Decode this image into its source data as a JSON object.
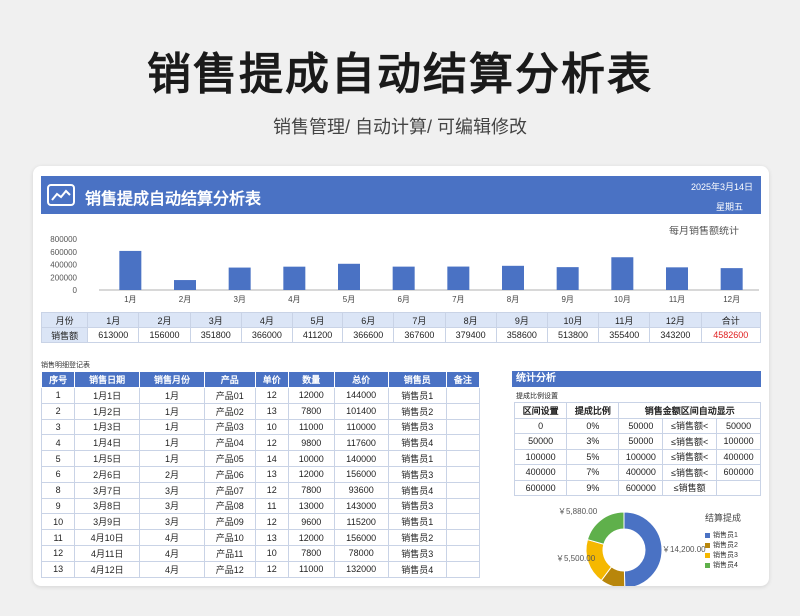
{
  "page": {
    "title": "销售提成自动结算分析表",
    "subtitle": "销售管理/ 自动计算/ 可编辑修改"
  },
  "banner": {
    "title": "销售提成自动结算分析表",
    "date": "2025年3月14日",
    "weekday": "星期五"
  },
  "chart_data": {
    "type": "bar",
    "title": "每月销售额统计",
    "categories": [
      "1月",
      "2月",
      "3月",
      "4月",
      "5月",
      "6月",
      "7月",
      "8月",
      "9月",
      "10月",
      "11月",
      "12月"
    ],
    "values": [
      613000,
      156000,
      351800,
      366000,
      411200,
      366600,
      367600,
      379400,
      358600,
      513800,
      355400,
      343200
    ],
    "ylim": [
      0,
      800000
    ],
    "yticks": [
      "800000",
      "600000",
      "400000",
      "200000",
      "0"
    ],
    "color": "#4a72c4"
  },
  "monthly": {
    "month_label": "月份",
    "sales_label": "销售额",
    "total_label": "合计",
    "months": [
      "1月",
      "2月",
      "3月",
      "4月",
      "5月",
      "6月",
      "7月",
      "8月",
      "9月",
      "10月",
      "11月",
      "12月"
    ],
    "values": [
      "613000",
      "156000",
      "351800",
      "366000",
      "411200",
      "366600",
      "367600",
      "379400",
      "358600",
      "513800",
      "355400",
      "343200"
    ],
    "total": "4582600"
  },
  "detail": {
    "label": "销售明细登记表",
    "headers": [
      "序号",
      "销售日期",
      "销售月份",
      "产品",
      "单价",
      "数量",
      "总价",
      "销售员",
      "备注"
    ],
    "rows": [
      [
        "1",
        "1月1日",
        "1月",
        "产品01",
        "12",
        "12000",
        "144000",
        "销售员1",
        ""
      ],
      [
        "2",
        "1月2日",
        "1月",
        "产品02",
        "13",
        "7800",
        "101400",
        "销售员2",
        ""
      ],
      [
        "3",
        "1月3日",
        "1月",
        "产品03",
        "10",
        "11000",
        "110000",
        "销售员3",
        ""
      ],
      [
        "4",
        "1月4日",
        "1月",
        "产品04",
        "12",
        "9800",
        "117600",
        "销售员4",
        ""
      ],
      [
        "5",
        "1月5日",
        "1月",
        "产品05",
        "14",
        "10000",
        "140000",
        "销售员1",
        ""
      ],
      [
        "6",
        "2月6日",
        "2月",
        "产品06",
        "13",
        "12000",
        "156000",
        "销售员3",
        ""
      ],
      [
        "8",
        "3月7日",
        "3月",
        "产品07",
        "12",
        "7800",
        "93600",
        "销售员4",
        ""
      ],
      [
        "9",
        "3月8日",
        "3月",
        "产品08",
        "11",
        "13000",
        "143000",
        "销售员3",
        ""
      ],
      [
        "10",
        "3月9日",
        "3月",
        "产品09",
        "12",
        "9600",
        "115200",
        "销售员1",
        ""
      ],
      [
        "11",
        "4月10日",
        "4月",
        "产品10",
        "13",
        "12000",
        "156000",
        "销售员2",
        ""
      ],
      [
        "12",
        "4月11日",
        "4月",
        "产品11",
        "10",
        "7800",
        "78000",
        "销售员3",
        ""
      ],
      [
        "13",
        "4月12日",
        "4月",
        "产品12",
        "12",
        "11000",
        "132000",
        "销售员4",
        ""
      ]
    ]
  },
  "stats": {
    "title": "统计分析",
    "sub": "提成比例设置",
    "headers": [
      "区间设置",
      "提成比例",
      "销售金额区间自动显示"
    ],
    "rows": [
      [
        "0",
        "0%",
        "50000",
        "≤销售额<",
        "50000"
      ],
      [
        "50000",
        "3%",
        "50000",
        "≤销售额<",
        "100000"
      ],
      [
        "100000",
        "5%",
        "100000",
        "≤销售额<",
        "400000"
      ],
      [
        "400000",
        "7%",
        "400000",
        "≤销售额<",
        "600000"
      ],
      [
        "600000",
        "9%",
        "600000",
        "≤销售额",
        ""
      ]
    ]
  },
  "donut": {
    "title": "结算提成",
    "legend": [
      "销售员1",
      "销售员2",
      "销售员3",
      "销售员4"
    ],
    "colors": [
      "#4a72c4",
      "#b8860b",
      "#f5b800",
      "#5fb04b"
    ],
    "values": [
      14200,
      3000,
      5500,
      5880
    ],
    "labels": [
      "￥14,200.00",
      "",
      "￥5,500.00",
      "￥5,880.00"
    ]
  }
}
